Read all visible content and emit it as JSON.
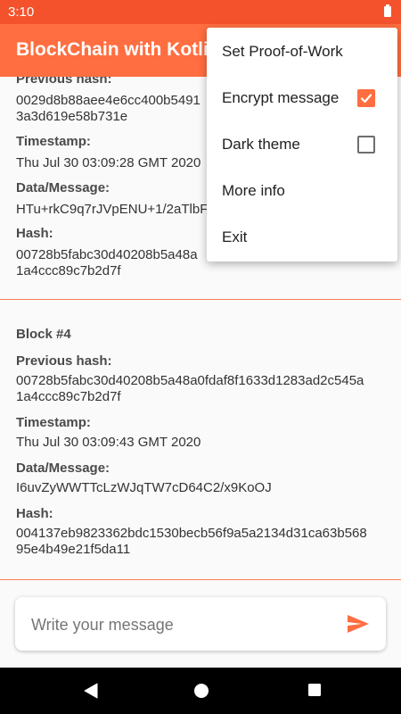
{
  "status_bar": {
    "time": "3:10"
  },
  "app_bar": {
    "title": "BlockChain with Kotlin"
  },
  "blocks": [
    {
      "previous_hash_label": "Previous hash:",
      "previous_hash_line1": "0029d8b88aee4e6cc400b5491",
      "previous_hash_line2": "3a3d619e58b731e",
      "timestamp_label": "Timestamp:",
      "timestamp": "Thu Jul 30 03:09:28 GMT 2020",
      "data_label": "Data/Message:",
      "data": "HTu+rkC9q7rJVpENU+1/2aTlbF",
      "hash_label": "Hash:",
      "hash_line1": "00728b5fabc30d40208b5a48a",
      "hash_line2": "1a4ccc89c7b2d7f"
    },
    {
      "title": "Block #4",
      "previous_hash_label": "Previous hash:",
      "previous_hash_line1": "00728b5fabc30d40208b5a48a0fdaf8f1633d1283ad2c545a",
      "previous_hash_line2": "1a4ccc89c7b2d7f",
      "timestamp_label": "Timestamp:",
      "timestamp": "Thu Jul 30 03:09:43 GMT 2020",
      "data_label": "Data/Message:",
      "data": "I6uvZyWWTTcLzWJqTW7cD64C2/x9KoOJ",
      "hash_label": "Hash:",
      "hash_line1": "004137eb9823362bdc1530becb56f9a5a2134d31ca63b568",
      "hash_line2": "95e4b49e21f5da11"
    }
  ],
  "message_input": {
    "placeholder": "Write your message"
  },
  "menu": {
    "items": [
      {
        "label": "Set Proof-of-Work"
      },
      {
        "label": "Encrypt message",
        "checked": true
      },
      {
        "label": "Dark theme",
        "checked": false
      },
      {
        "label": "More info"
      },
      {
        "label": "Exit"
      }
    ]
  },
  "colors": {
    "status_bar": "#f4522d",
    "app_bar": "#ff6e40",
    "accent": "#ff6e40",
    "divider": "#ff7a55"
  },
  "icons": {
    "send": "send-icon",
    "battery": "battery-icon",
    "back": "back-icon",
    "home": "home-icon",
    "recents": "recents-icon"
  }
}
